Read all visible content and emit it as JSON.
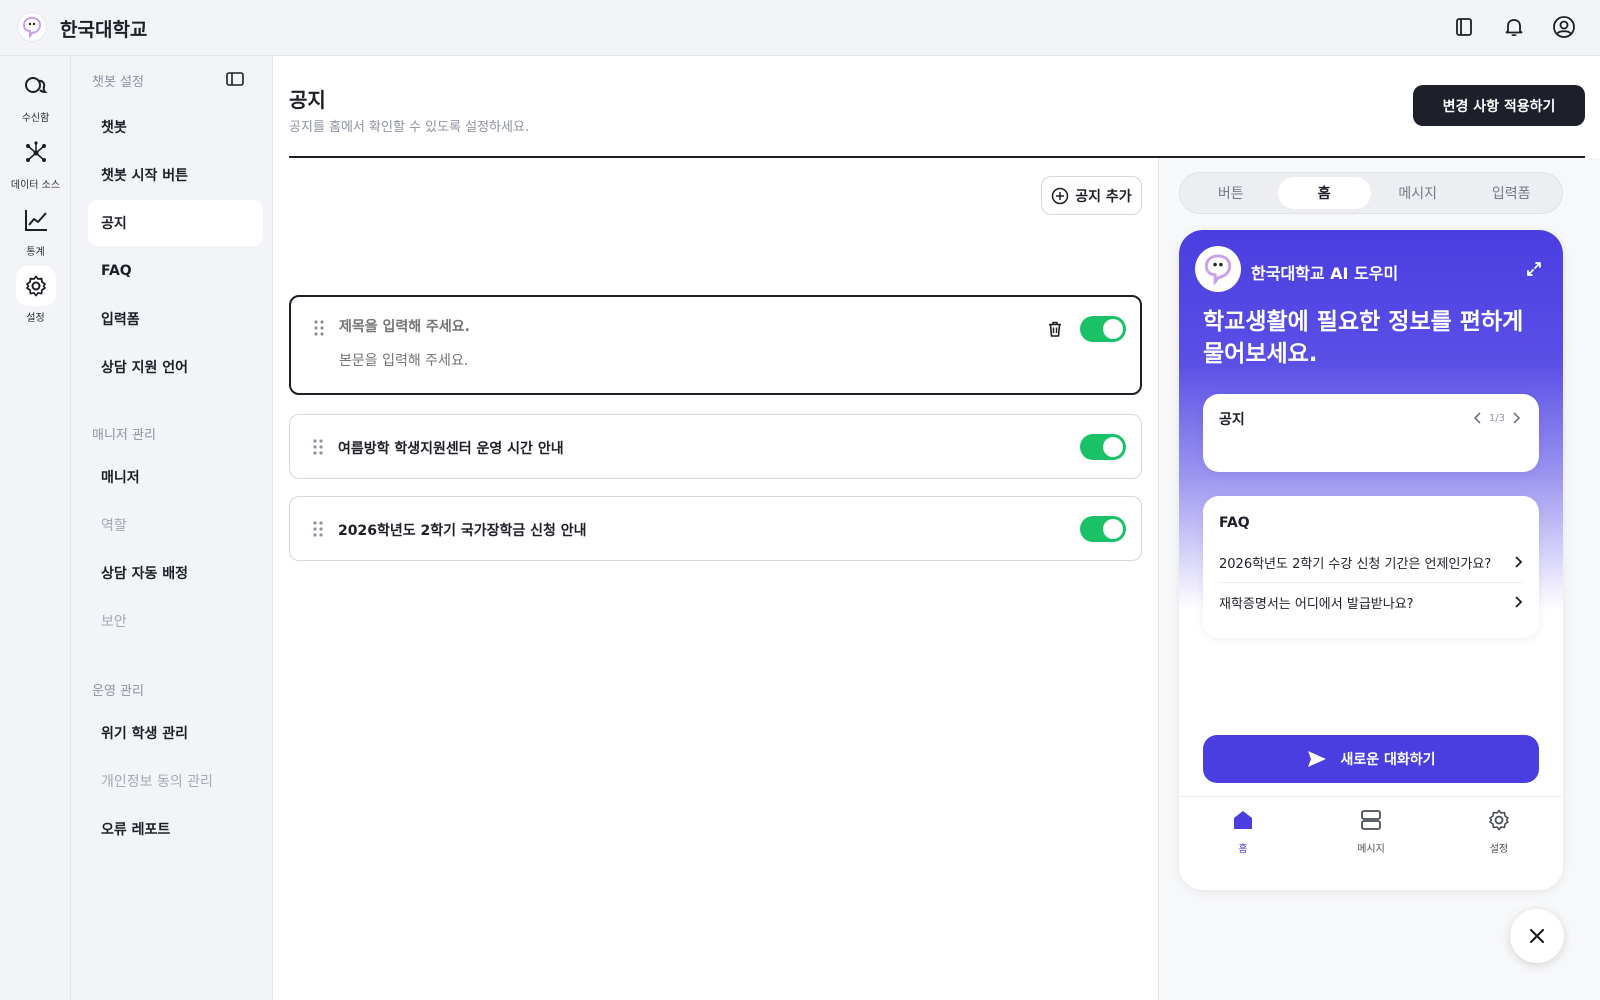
{
  "brand": {
    "name": "한국대학교"
  },
  "topbar": {
    "icons": [
      "book-icon",
      "bell-icon",
      "user-icon"
    ]
  },
  "rail": {
    "items": [
      {
        "label": "수신함",
        "icon": "inbox-icon"
      },
      {
        "label": "데이터 소스",
        "icon": "data-source-icon"
      },
      {
        "label": "통계",
        "icon": "chart-icon"
      },
      {
        "label": "설정",
        "icon": "gear-icon",
        "active": true
      }
    ]
  },
  "sidebar": {
    "groups": [
      {
        "title": "챗봇 설정",
        "items": [
          {
            "label": "챗봇"
          },
          {
            "label": "챗봇 시작 버튼"
          },
          {
            "label": "공지",
            "active": true
          },
          {
            "label": "FAQ"
          },
          {
            "label": "입력폼"
          },
          {
            "label": "상담 지원 언어"
          }
        ]
      },
      {
        "title": "매니저 관리",
        "items": [
          {
            "label": "매니저"
          },
          {
            "label": "역할",
            "disabled": true
          },
          {
            "label": "상담 자동 배정"
          },
          {
            "label": "보안",
            "disabled": true
          }
        ]
      },
      {
        "title": "운영 관리",
        "items": [
          {
            "label": "위기 학생 관리"
          },
          {
            "label": "개인정보 동의 관리",
            "disabled": true
          },
          {
            "label": "오류 레포트"
          }
        ]
      }
    ]
  },
  "page": {
    "title": "공지",
    "subtitle": "공지를 홈에서 확인할 수 있도록 설정하세요.",
    "apply_label": "변경 사항 적용하기",
    "add_label": "공지 추가"
  },
  "notices": {
    "editing": {
      "title_placeholder": "제목을 입력해 주세요.",
      "body_placeholder": "본문을 입력해 주세요.",
      "enabled": true
    },
    "items": [
      {
        "title": "여름방학 학생지원센터 운영 시간 안내",
        "enabled": true
      },
      {
        "title": "2026학년도 2학기 국가장학금 신청 안내",
        "enabled": true
      }
    ]
  },
  "preview": {
    "tabs": [
      "버튼",
      "홈",
      "메시지",
      "입력폼"
    ],
    "active_tab": "홈",
    "bot_name": "한국대학교 AI 도우미",
    "headline": "학교생활에 필요한 정보를 편하게 물어보세요.",
    "notice_card": {
      "title": "공지",
      "pager": "1/3"
    },
    "faq_card": {
      "title": "FAQ",
      "items": [
        "2026학년도 2학기 수강 신청 기간은 언제인가요?",
        "재학증명서는 어디에서 발급받나요?"
      ]
    },
    "new_chat_label": "새로운 대화하기",
    "nav": [
      {
        "label": "홈",
        "icon": "home-icon",
        "active": true
      },
      {
        "label": "메시지",
        "icon": "messages-icon"
      },
      {
        "label": "설정",
        "icon": "gear-icon"
      }
    ],
    "colors": {
      "accent": "#4a3ee0",
      "toggle_on": "#19c167"
    }
  }
}
